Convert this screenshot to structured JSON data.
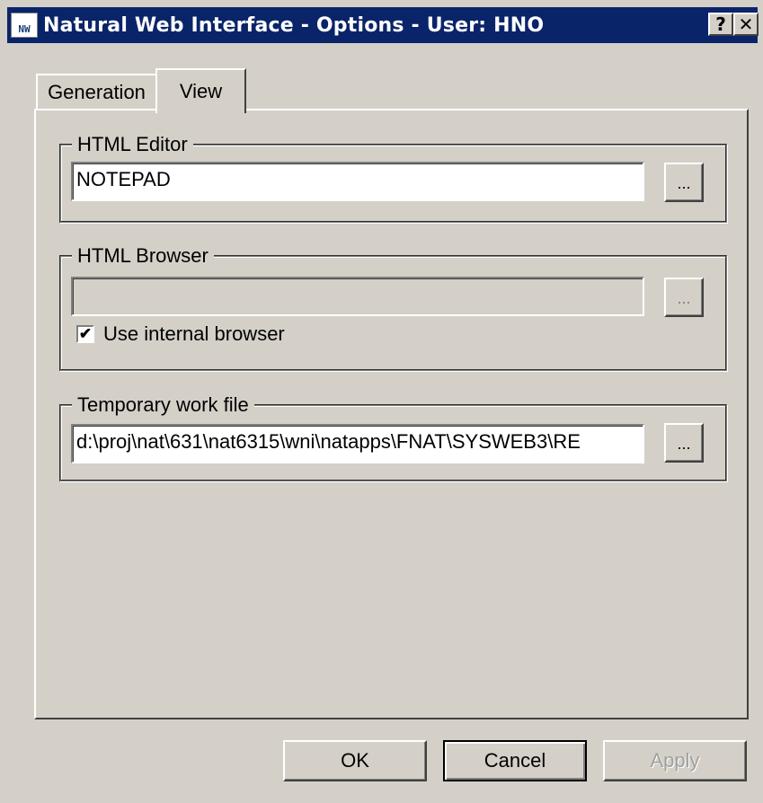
{
  "window": {
    "title": "Natural Web Interface - Options - User: HNO",
    "icon_label": "NW",
    "help_button": "?",
    "close_button": "✕"
  },
  "tabs": [
    {
      "label": "Generation",
      "selected": false
    },
    {
      "label": "View",
      "selected": true
    }
  ],
  "html_editor": {
    "legend": "HTML Editor",
    "value": "NOTEPAD",
    "browse_label": "..."
  },
  "html_browser": {
    "legend": "HTML Browser",
    "value": "",
    "browse_label": "...",
    "disabled": true,
    "checkbox_label": "Use internal browser",
    "checkbox_checked": true
  },
  "temp_work_file": {
    "legend": "Temporary work file",
    "value": "d:\\proj\\nat\\631\\nat6315\\wni\\natapps\\FNAT\\SYSWEB3\\RE",
    "browse_label": "..."
  },
  "buttons": {
    "ok": "OK",
    "cancel": "Cancel",
    "apply": "Apply"
  }
}
